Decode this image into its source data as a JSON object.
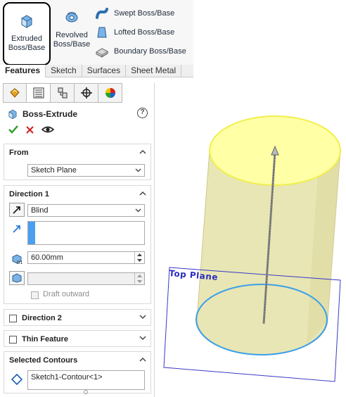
{
  "ribbon": {
    "extruded": {
      "line1": "Extruded",
      "line2": "Boss/Base"
    },
    "revolved": {
      "line1": "Revolved",
      "line2": "Boss/Base"
    },
    "swept": "Swept Boss/Base",
    "lofted": "Lofted Boss/Base",
    "boundary": "Boundary Boss/Base"
  },
  "tabs": [
    "Features",
    "Sketch",
    "Surfaces",
    "Sheet Metal"
  ],
  "pm": {
    "title": "Boss-Extrude",
    "help": "?",
    "from": {
      "header": "From",
      "value": "Sketch Plane"
    },
    "direction1": {
      "header": "Direction 1",
      "end_condition": "Blind",
      "depth": "60.00mm",
      "draft_label": "Draft outward"
    },
    "direction2": {
      "header": "Direction 2"
    },
    "thin": {
      "header": "Thin Feature"
    },
    "contours": {
      "header": "Selected Contours",
      "item": "Sketch1-Contour<1>"
    }
  },
  "viewport": {
    "plane_label": "Top Plane"
  },
  "colors": {
    "cylinder_body": "#e8e6b4",
    "cylinder_top": "#ffffa6",
    "top_outline": "#f1ef4a",
    "sketch_circle": "#3aa0ea",
    "plane": "#3a3ac8",
    "ok": "#2f9a2f",
    "cancel": "#d11f1f"
  }
}
